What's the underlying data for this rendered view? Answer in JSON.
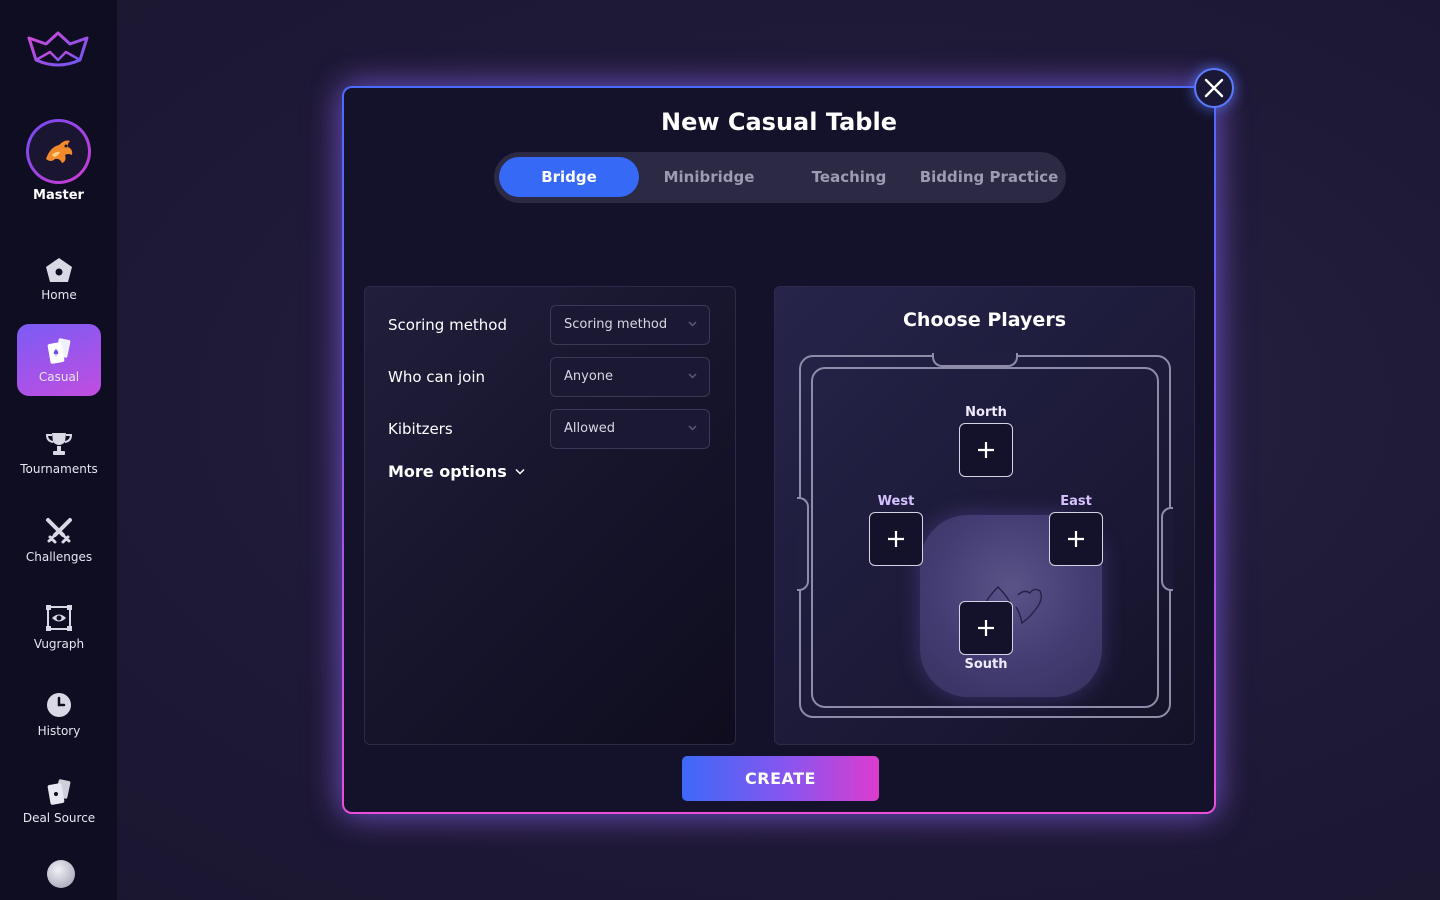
{
  "sidebar": {
    "profile": {
      "rank_label": "Master"
    },
    "items": [
      {
        "label": "Home",
        "icon": "home-icon"
      },
      {
        "label": "Casual",
        "icon": "cards-icon",
        "active": true
      },
      {
        "label": "Tournaments",
        "icon": "trophy-icon"
      },
      {
        "label": "Challenges",
        "icon": "swords-icon"
      },
      {
        "label": "Vugraph",
        "icon": "eye-frame-icon"
      },
      {
        "label": "History",
        "icon": "clock-icon"
      },
      {
        "label": "Deal Source",
        "icon": "deal-cards-icon"
      }
    ]
  },
  "modal": {
    "title": "New Casual Table",
    "tabs": [
      {
        "label": "Bridge",
        "active": true
      },
      {
        "label": "Minibridge"
      },
      {
        "label": "Teaching"
      },
      {
        "label": "Bidding Practice"
      }
    ],
    "settings": {
      "scoring": {
        "label": "Scoring method",
        "value": "Scoring method"
      },
      "join": {
        "label": "Who can join",
        "value": "Anyone"
      },
      "kibitzers": {
        "label": "Kibitzers",
        "value": "Allowed"
      },
      "more_options": "More options"
    },
    "players": {
      "title": "Choose Players",
      "north": "North",
      "south": "South",
      "east": "East",
      "west": "West"
    },
    "create_label": "CREATE"
  },
  "colors": {
    "accent_blue": "#3569f6",
    "accent_pink": "#dc3ccf",
    "background": "#1f1b38",
    "sidebar": "#0f0d22"
  }
}
